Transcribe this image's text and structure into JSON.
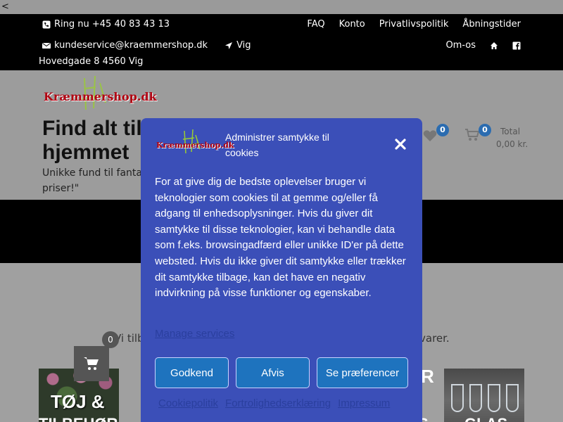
{
  "nav": {
    "back": "<"
  },
  "topbar": {
    "phone": "Ring nu +45 40 83 43 13",
    "email": "kundeservice@kraemmershop.dk",
    "directions": "Vig",
    "links": [
      "FAQ",
      "Konto",
      "Privatlivspolitik",
      "Åbningstider"
    ],
    "about": "Om-os",
    "address": "Hovedgade 8 4560 Vig"
  },
  "header": {
    "logo_text": "Kræmmershop.dk",
    "tagline_line1": "Find alt til",
    "tagline_line2": "hjemmet",
    "sub_line1": "Unikke fund til fantast",
    "sub_line2": "priser!\"",
    "wishlist_count": "0",
    "cart_count": "0",
    "total_label": "Total",
    "total_value": "0,00 kr."
  },
  "content": {
    "intro_left": "Vi tilb",
    "intro_right": "varer.",
    "category1_title_line1": "TØJ &",
    "category1_title_line2": "TILBEHØR",
    "partial_right_title": "R",
    "partial_right_bottom": "S",
    "category2_title": "GLAS",
    "float_cart_count": "0"
  },
  "modal": {
    "logo_text": "Kræmmershop.dk",
    "title": "Administrer samtykke til cookies",
    "body": "For at give dig de bedste oplevelser bruger vi teknologier som cookies til at gemme og/eller få adgang til enhedsoplysninger. Hvis du giver dit samtykke til disse teknologier, kan vi behandle data som f.eks. browsingadfærd eller unikke ID'er på dette websted. Hvis du ikke giver dit samtykke eller trækker dit samtykke tilbage, kan det have en negativ indvirkning på visse funktioner og egenskaber.",
    "manage_services": "Manage services",
    "accept": "Godkend",
    "deny": "Afvis",
    "preferences": "Se præferencer",
    "footer_links": [
      "Cookiepolitik",
      "Fortrolighedserklæring",
      "Impressum"
    ]
  },
  "colors": {
    "modal_bg": "#3b4fb8",
    "button_bg": "#1e73be",
    "badge": "#2b6cb0",
    "logo_red": "#b00010"
  }
}
